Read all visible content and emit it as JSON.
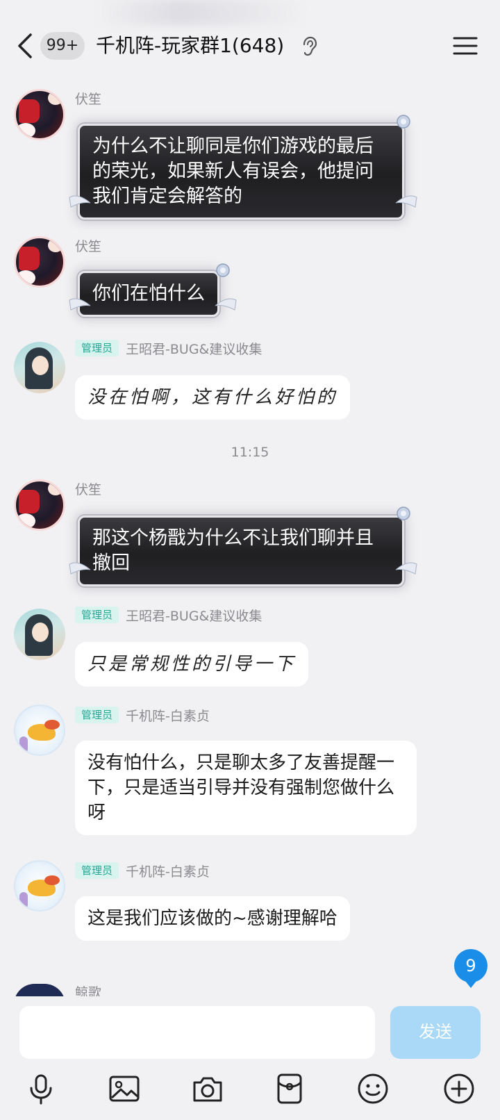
{
  "header": {
    "unread_badge": "99+",
    "title": "千机阵-玩家群1(648)"
  },
  "messages": [
    {
      "sender": "伏笙",
      "text": "为什么不让聊同是你们游戏的最后的荣光，如果新人有误会，他提问我们肯定会解答的"
    },
    {
      "sender": "伏笙",
      "text": "你们在怕什么"
    },
    {
      "admin_tag": "管理员",
      "sender": "王昭君-BUG&建议收集",
      "text": "没在怕啊，这有什么好怕的"
    },
    {
      "sender": "伏笙",
      "text": "那这个杨戬为什么不让我们聊并且撤回"
    },
    {
      "admin_tag": "管理员",
      "sender": "王昭君-BUG&建议收集",
      "text": "只是常规性的引导一下"
    },
    {
      "admin_tag": "管理员",
      "sender": "千机阵-白素贞",
      "text": "没有怕什么，只是聊太多了友善提醒一下，只是适当引导并没有强制您做什么呀"
    },
    {
      "admin_tag": "管理员",
      "sender": "千机阵-白素贞",
      "text": "这是我们应该做的~感谢理解哈"
    },
    {
      "sender": "鲸歌"
    }
  ],
  "timestamp": "11:15",
  "new_message_count": "9",
  "composer": {
    "send_label": "发送",
    "placeholder": ""
  },
  "toolbar_icons": [
    "microphone-icon",
    "image-icon",
    "camera-icon",
    "red-packet-icon",
    "emoji-icon",
    "plus-icon"
  ]
}
